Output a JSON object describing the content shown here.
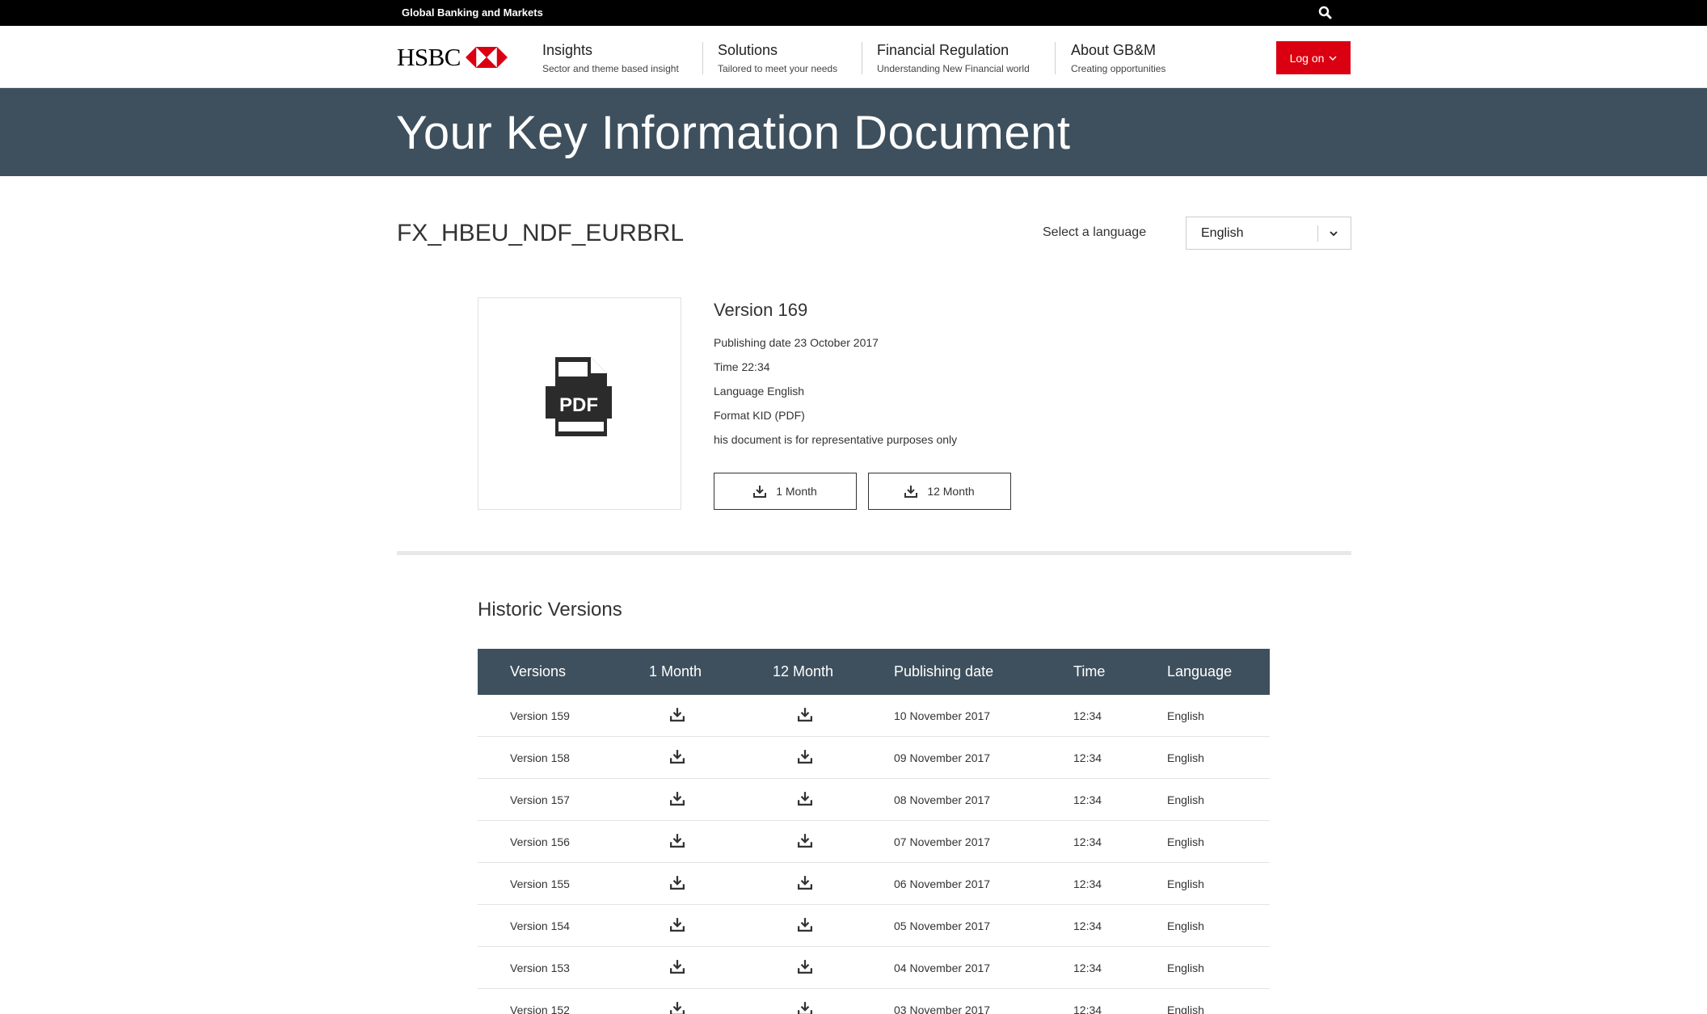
{
  "topbar": {
    "label": "Global Banking and Markets",
    "search_icon": "search-icon"
  },
  "brand": {
    "name": "HSBC",
    "mark_color": "#db0011"
  },
  "nav": {
    "items": [
      {
        "title": "Insights",
        "subtitle": "Sector and theme based insight"
      },
      {
        "title": "Solutions",
        "subtitle": "Tailored to meet your needs"
      },
      {
        "title": "Financial Regulation",
        "subtitle": "Understanding New Financial world"
      },
      {
        "title": "About GB&M",
        "subtitle": "Creating opportunities"
      }
    ],
    "login_label": "Log on"
  },
  "hero": {
    "title": "Your Key Information Document"
  },
  "document": {
    "id": "FX_HBEU_NDF_EURBRL",
    "language_label": "Select a language",
    "language_value": "English"
  },
  "current": {
    "version": "Version 169",
    "publishing_date": "Publishing date 23 October 2017",
    "time": "Time 22:34",
    "language": "Language English",
    "format": "Format KID (PDF)",
    "note": "his document is for representative purposes only",
    "pdf_label": "PDF",
    "btn_1": "1 Month",
    "btn_12": "12 Month"
  },
  "historic": {
    "title": "Historic Versions",
    "headers": [
      "Versions",
      "1 Month",
      "12 Month",
      "Publishing date",
      "Time",
      "Language"
    ],
    "rows": [
      {
        "version": "Version 159",
        "date": "10 November 2017",
        "time": "12:34",
        "language": "English"
      },
      {
        "version": "Version 158",
        "date": "09 November 2017",
        "time": "12:34",
        "language": "English"
      },
      {
        "version": "Version 157",
        "date": "08 November 2017",
        "time": "12:34",
        "language": "English"
      },
      {
        "version": "Version 156",
        "date": "07 November 2017",
        "time": "12:34",
        "language": "English"
      },
      {
        "version": "Version 155",
        "date": "06 November 2017",
        "time": "12:34",
        "language": "English"
      },
      {
        "version": "Version 154",
        "date": "05 November 2017",
        "time": "12:34",
        "language": "English"
      },
      {
        "version": "Version 153",
        "date": "04 November 2017",
        "time": "12:34",
        "language": "English"
      },
      {
        "version": "Version 152",
        "date": "03 November 2017",
        "time": "12:34",
        "language": "English"
      }
    ]
  },
  "colors": {
    "accent": "#db0011",
    "header_bg": "#3e505d",
    "topbar_bg": "#000000"
  }
}
